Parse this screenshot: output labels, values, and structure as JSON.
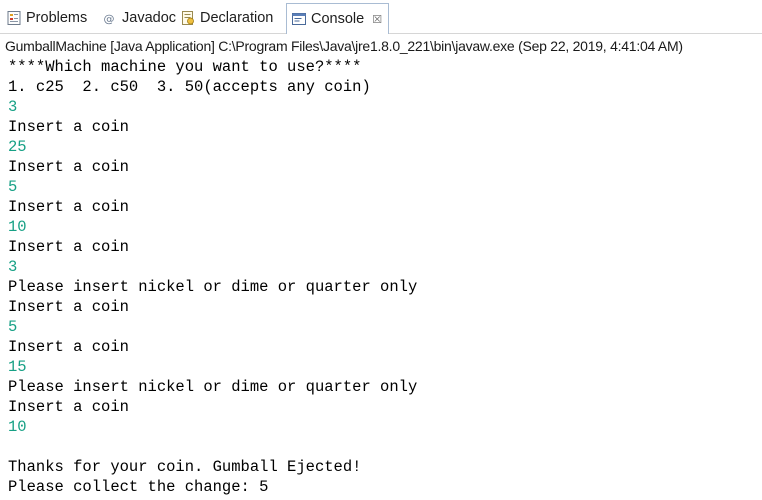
{
  "tabs": [
    {
      "label": "Problems",
      "icon": "problems-icon",
      "active": false
    },
    {
      "label": "Javadoc",
      "icon": "javadoc-icon",
      "active": false
    },
    {
      "label": "Declaration",
      "icon": "declaration-icon",
      "active": false
    },
    {
      "label": "Console",
      "icon": "console-icon",
      "active": true,
      "close": "☒"
    }
  ],
  "launch_info": "GumballMachine [Java Application] C:\\Program Files\\Java\\jre1.8.0_221\\bin\\javaw.exe (Sep 22, 2019, 4:41:04 AM)",
  "colors": {
    "output": "#000000",
    "user_input": "#17a085",
    "active_tab_border": "#a9bcd3"
  },
  "console_lines": [
    {
      "text": "****Which machine you want to use?****",
      "kind": "output"
    },
    {
      "text": "1. c25  2. c50  3. 50(accepts any coin)",
      "kind": "output"
    },
    {
      "text": "3",
      "kind": "input"
    },
    {
      "text": "Insert a coin",
      "kind": "output"
    },
    {
      "text": "25",
      "kind": "input"
    },
    {
      "text": "Insert a coin",
      "kind": "output"
    },
    {
      "text": "5",
      "kind": "input"
    },
    {
      "text": "Insert a coin",
      "kind": "output"
    },
    {
      "text": "10",
      "kind": "input"
    },
    {
      "text": "Insert a coin",
      "kind": "output"
    },
    {
      "text": "3",
      "kind": "input"
    },
    {
      "text": "Please insert nickel or dime or quarter only",
      "kind": "output"
    },
    {
      "text": "Insert a coin",
      "kind": "output"
    },
    {
      "text": "5",
      "kind": "input"
    },
    {
      "text": "Insert a coin",
      "kind": "output"
    },
    {
      "text": "15",
      "kind": "input"
    },
    {
      "text": "Please insert nickel or dime or quarter only",
      "kind": "output"
    },
    {
      "text": "Insert a coin",
      "kind": "output"
    },
    {
      "text": "10",
      "kind": "input"
    },
    {
      "text": "",
      "kind": "output"
    },
    {
      "text": "Thanks for your coin. Gumball Ejected!",
      "kind": "output"
    },
    {
      "text": "Please collect the change: 5",
      "kind": "output"
    }
  ]
}
